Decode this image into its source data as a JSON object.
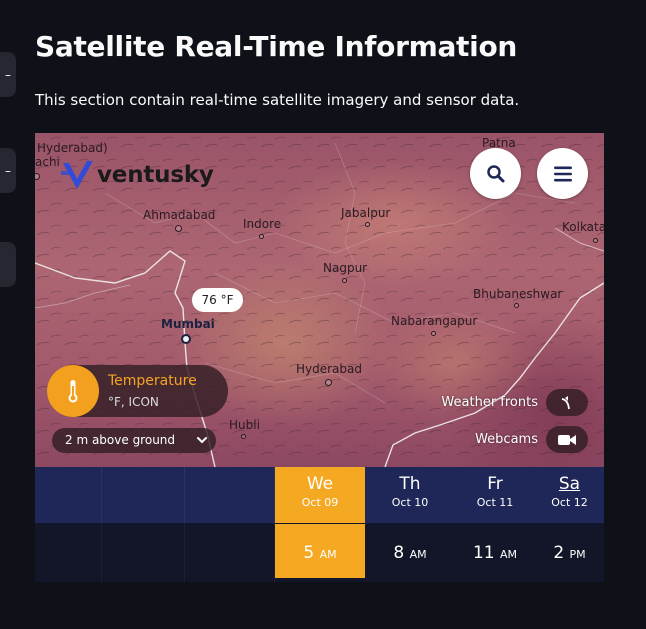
{
  "page": {
    "title": "Satellite Real-Time Information",
    "description": "This section contain real-time satellite imagery and sensor data."
  },
  "map": {
    "brand": "ventusky",
    "cities": {
      "hyderabad_top": "Hyderabad)",
      "karachi": "achi",
      "patna": "Patna",
      "ahmadabad": "Ahmadabad",
      "indore": "Indore",
      "jabalpur": "Jabalpur",
      "kolkata": "Kolkata",
      "nagpur": "Nagpur",
      "mumbai": "Mumbai",
      "bhubaneshwar": "Bhubaneshwar",
      "nabarangapur": "Nabarangapur",
      "hyderabad": "Hyderabad",
      "hubli": "Hubli"
    },
    "temp_bubble": "76 °F",
    "layer": {
      "name": "Temperature",
      "unit_model": "°F, ICON",
      "icon": "thermometer-icon",
      "accent": "#f2a01e"
    },
    "level_select": "2 m above ground",
    "weather_fronts_label": "Weather fronts",
    "webcams_label": "Webcams",
    "search_icon": "search-icon",
    "menu_icon": "menu-icon"
  },
  "timeline": {
    "days": [
      {
        "name": "We",
        "date": "Oct 09",
        "active": true
      },
      {
        "name": "Th",
        "date": "Oct 10",
        "active": false
      },
      {
        "name": "Fr",
        "date": "Oct 11",
        "active": false
      },
      {
        "name": "Sa",
        "date": "Oct 12",
        "active": false
      }
    ],
    "hours": [
      {
        "h": "5",
        "ap": "AM",
        "active": true
      },
      {
        "h": "8",
        "ap": "AM",
        "active": false
      },
      {
        "h": "11",
        "ap": "AM",
        "active": false
      },
      {
        "h": "2",
        "ap": "PM",
        "active": false
      }
    ]
  },
  "colors": {
    "background": "#0e1117",
    "active_orange": "#f5a821",
    "timeline_day_row": "#1e2757"
  }
}
